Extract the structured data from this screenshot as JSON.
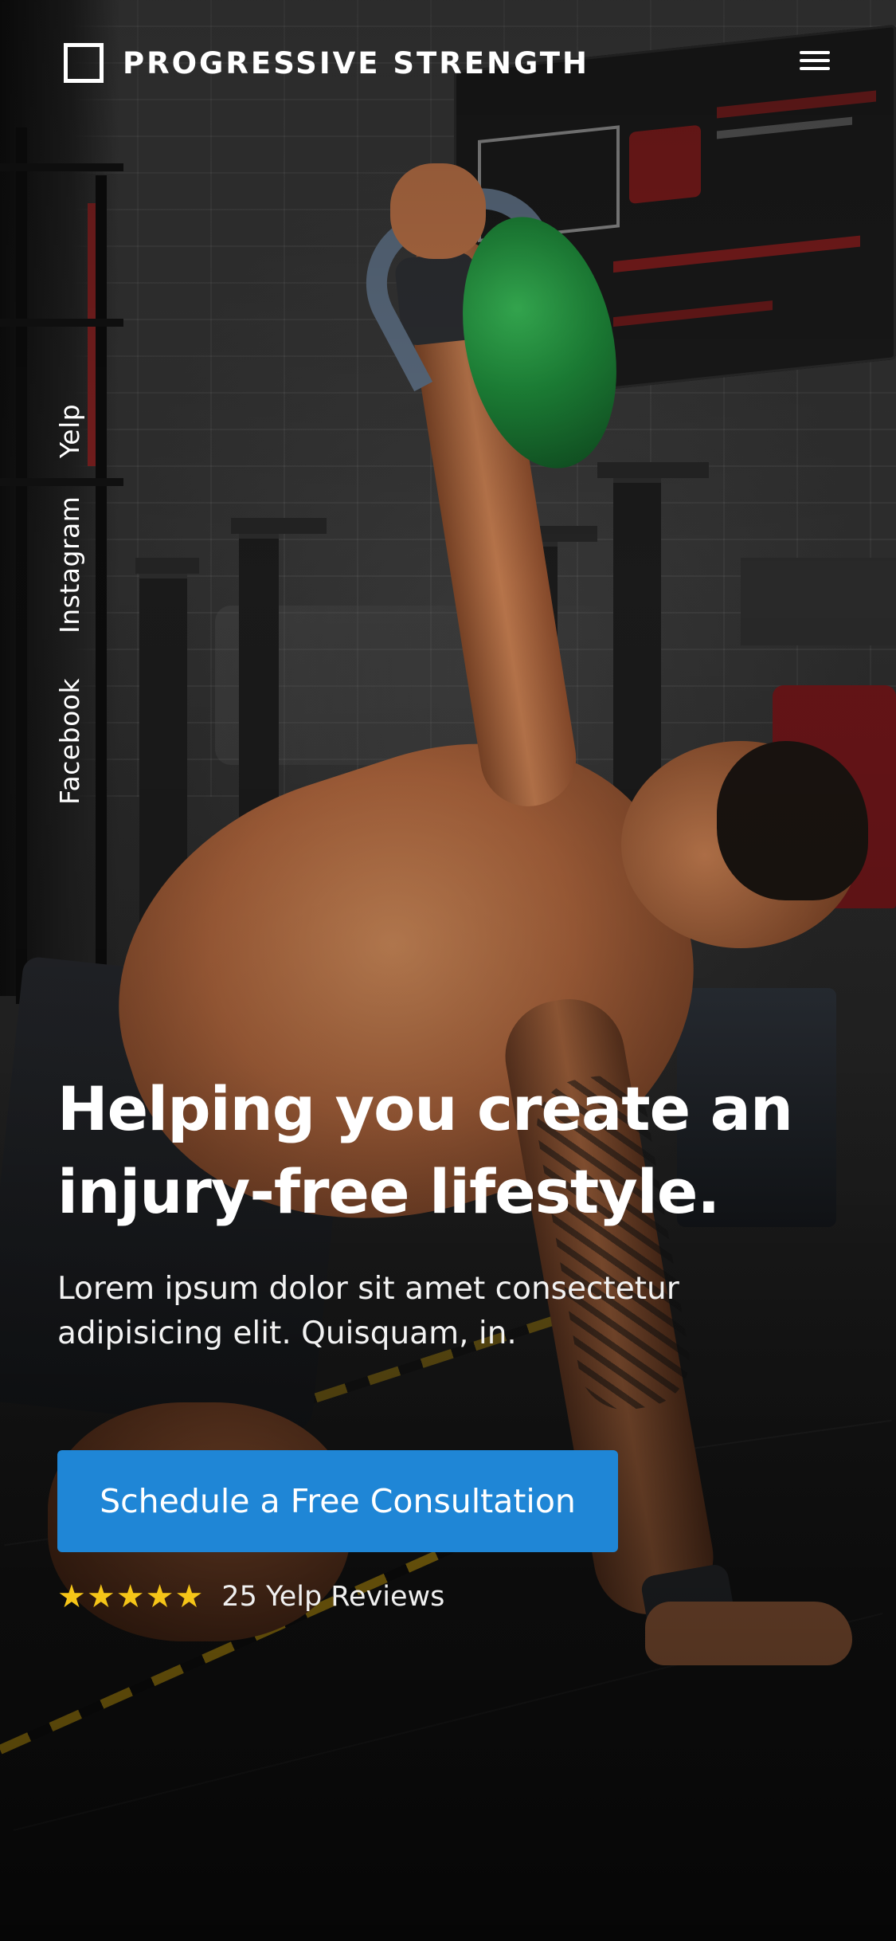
{
  "header": {
    "brand_name": "PROGRESSIVE STRENGTH",
    "menu_icon": "hamburger-menu-icon"
  },
  "social_links": {
    "yelp": "Yelp",
    "instagram": "Instagram",
    "facebook": "Facebook"
  },
  "hero": {
    "title_line1": "Helping you create an",
    "title_line2": "injury-free lifestyle.",
    "subtitle_line1": "Lorem ipsum dolor sit amet consectetur",
    "subtitle_line2": "adipisicing elit. Quisquam, in.",
    "cta_label": "Schedule a Free Consultation",
    "cta_color": "#1f86d6"
  },
  "rating": {
    "stars": 5,
    "star_glyph": "★",
    "star_color": "#f5c518",
    "reviews_label": "25 Yelp Reviews"
  },
  "background": {
    "image_subject": "athlete-kettlebell-photo"
  }
}
